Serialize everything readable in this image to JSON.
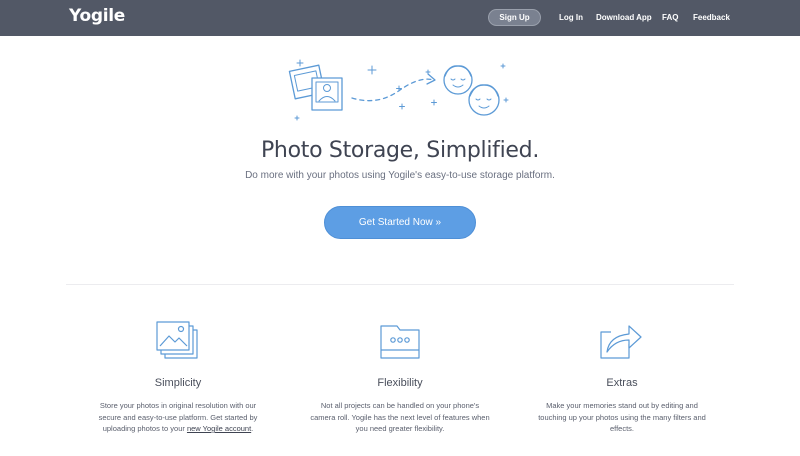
{
  "nav": {
    "logo": "Yogile",
    "signup": "Sign Up",
    "login": "Log In",
    "download": "Download App",
    "faq": "FAQ",
    "feedback": "Feedback"
  },
  "hero": {
    "title": "Photo Storage, Simplified.",
    "subtitle": "Do more with your photos using Yogile's easy-to-use storage platform.",
    "cta": "Get Started Now »"
  },
  "features": [
    {
      "icon": "photo-stack-icon",
      "title": "Simplicity",
      "text": "Store your photos in original resolution with our secure and easy-to-use platform. Get started by uploading photos to your ",
      "link": "new Yogile account",
      "text_after": "."
    },
    {
      "icon": "folder-icon",
      "title": "Flexibility",
      "text": "Not all projects can be handled on your phone's camera roll. Yogile has the next level of features when you need greater flexibility."
    },
    {
      "icon": "share-arrow-icon",
      "title": "Extras",
      "text": "Make your memories stand out by editing and touching up your photos using the many filters and effects."
    }
  ],
  "colors": {
    "navbar": "#525866",
    "accent": "#5d9ee4",
    "icon_stroke": "#5c9ad6"
  }
}
